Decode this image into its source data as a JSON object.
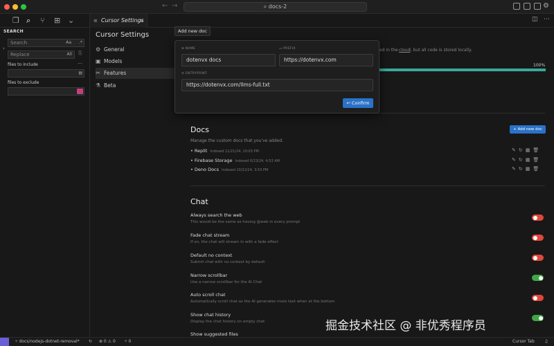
{
  "window": {
    "search_label": "docs-2"
  },
  "sidebar": {
    "title": "SEARCH",
    "search_placeholder": "Search",
    "case_toggle": "Aa",
    "replace_placeholder": "Replace",
    "replace_all": "All",
    "files_include": "files to include",
    "files_exclude": "files to exclude",
    "more": "…"
  },
  "tabs": [
    {
      "label": "Cursor Settings"
    }
  ],
  "settings_nav": {
    "title": "Cursor Settings",
    "items": [
      {
        "label": "General",
        "icon": "gear-icon"
      },
      {
        "label": "Models",
        "icon": "cube-icon"
      },
      {
        "label": "Features",
        "icon": "tools-icon"
      },
      {
        "label": "Beta",
        "icon": "flask-icon"
      }
    ]
  },
  "tooltip": {
    "text": "Add new doc"
  },
  "modal": {
    "name_label": "NAME",
    "name_value": "dotenvx docs",
    "prefix_label": "PREFIX",
    "prefix_value": "https://dotenvx.com",
    "entry_label": "ENTRYPOINT",
    "entry_value": "https://dotenvx.com/llms-full.txt",
    "confirm": "↩ Confirm"
  },
  "indexing": {
    "text_fragment": "ed in the cloud, but all code is stored locally.",
    "link_word": "cloud",
    "percent_label": "100%",
    "progress": 1.0
  },
  "docs": {
    "title": "Docs",
    "description": "Manage the custom docs that you've added.",
    "add_button": "+ Add new doc",
    "items": [
      {
        "name": "Replit",
        "meta": "Indexed 11/21/24, 10:03 PM"
      },
      {
        "name": "Firebase Storage",
        "meta": "Indexed 6/23/24, 4:53 AM"
      },
      {
        "name": "Deno Docs",
        "meta": "Indexed 10/22/24, 3:53 PM"
      }
    ]
  },
  "chat": {
    "title": "Chat",
    "options": [
      {
        "title": "Always search the web",
        "desc": "This would be the same as having @web in every prompt",
        "on": false
      },
      {
        "title": "Fade chat stream",
        "desc": "If on, the chat will stream in with a fade effect",
        "on": false
      },
      {
        "title": "Default no context",
        "desc": "Submit chat with no context by default",
        "on": false
      },
      {
        "title": "Narrow scrollbar",
        "desc": "Use a narrow scrollbar for the AI Chat",
        "on": true
      },
      {
        "title": "Auto scroll chat",
        "desc": "Automatically scroll chat as the AI generates more text when at the bottom",
        "on": false
      },
      {
        "title": "Show chat history",
        "desc": "Display the chat history on empty chat",
        "on": true
      },
      {
        "title": "Show suggested files",
        "desc": "",
        "on": false
      }
    ]
  },
  "status": {
    "branch": "docs/nodejs-dotnet-removal*",
    "errors": "⊗ 0 ⚠ 0",
    "ports": "⑂ 0",
    "right_label": "Cursor Tab"
  },
  "watermark": "掘金技术社区 @ 非优秀程序员",
  "colors": {
    "accent": "#2a72c7",
    "toggle_off": "#e0473b",
    "toggle_on": "#3fa844",
    "progress": "#3aa89b"
  }
}
